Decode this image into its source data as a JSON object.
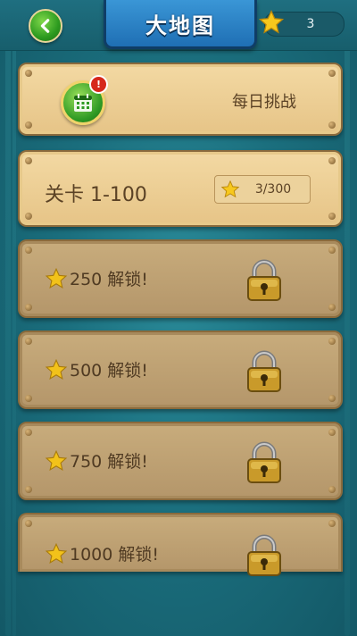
{
  "header": {
    "title": "大地图",
    "star_total": "3"
  },
  "daily_challenge": {
    "label": "每日挑战",
    "badge": "!"
  },
  "level_pack": {
    "label": "关卡 1-100",
    "progress": "3/300"
  },
  "locked_packs": [
    {
      "label": "250 解锁!"
    },
    {
      "label": "500 解锁!"
    },
    {
      "label": "750 解锁!"
    },
    {
      "label": "1000 解锁!"
    }
  ],
  "colors": {
    "background": "#1b6f7e",
    "panel_active": "#f0d49c",
    "panel_locked": "#bfa273",
    "title_plate": "#2a84c8",
    "back_button": "#3aa82a",
    "badge": "#d6281c"
  },
  "icons": {
    "back": "chevron-left-icon",
    "star": "star-icon",
    "calendar": "calendar-icon",
    "lock": "padlock-icon"
  }
}
